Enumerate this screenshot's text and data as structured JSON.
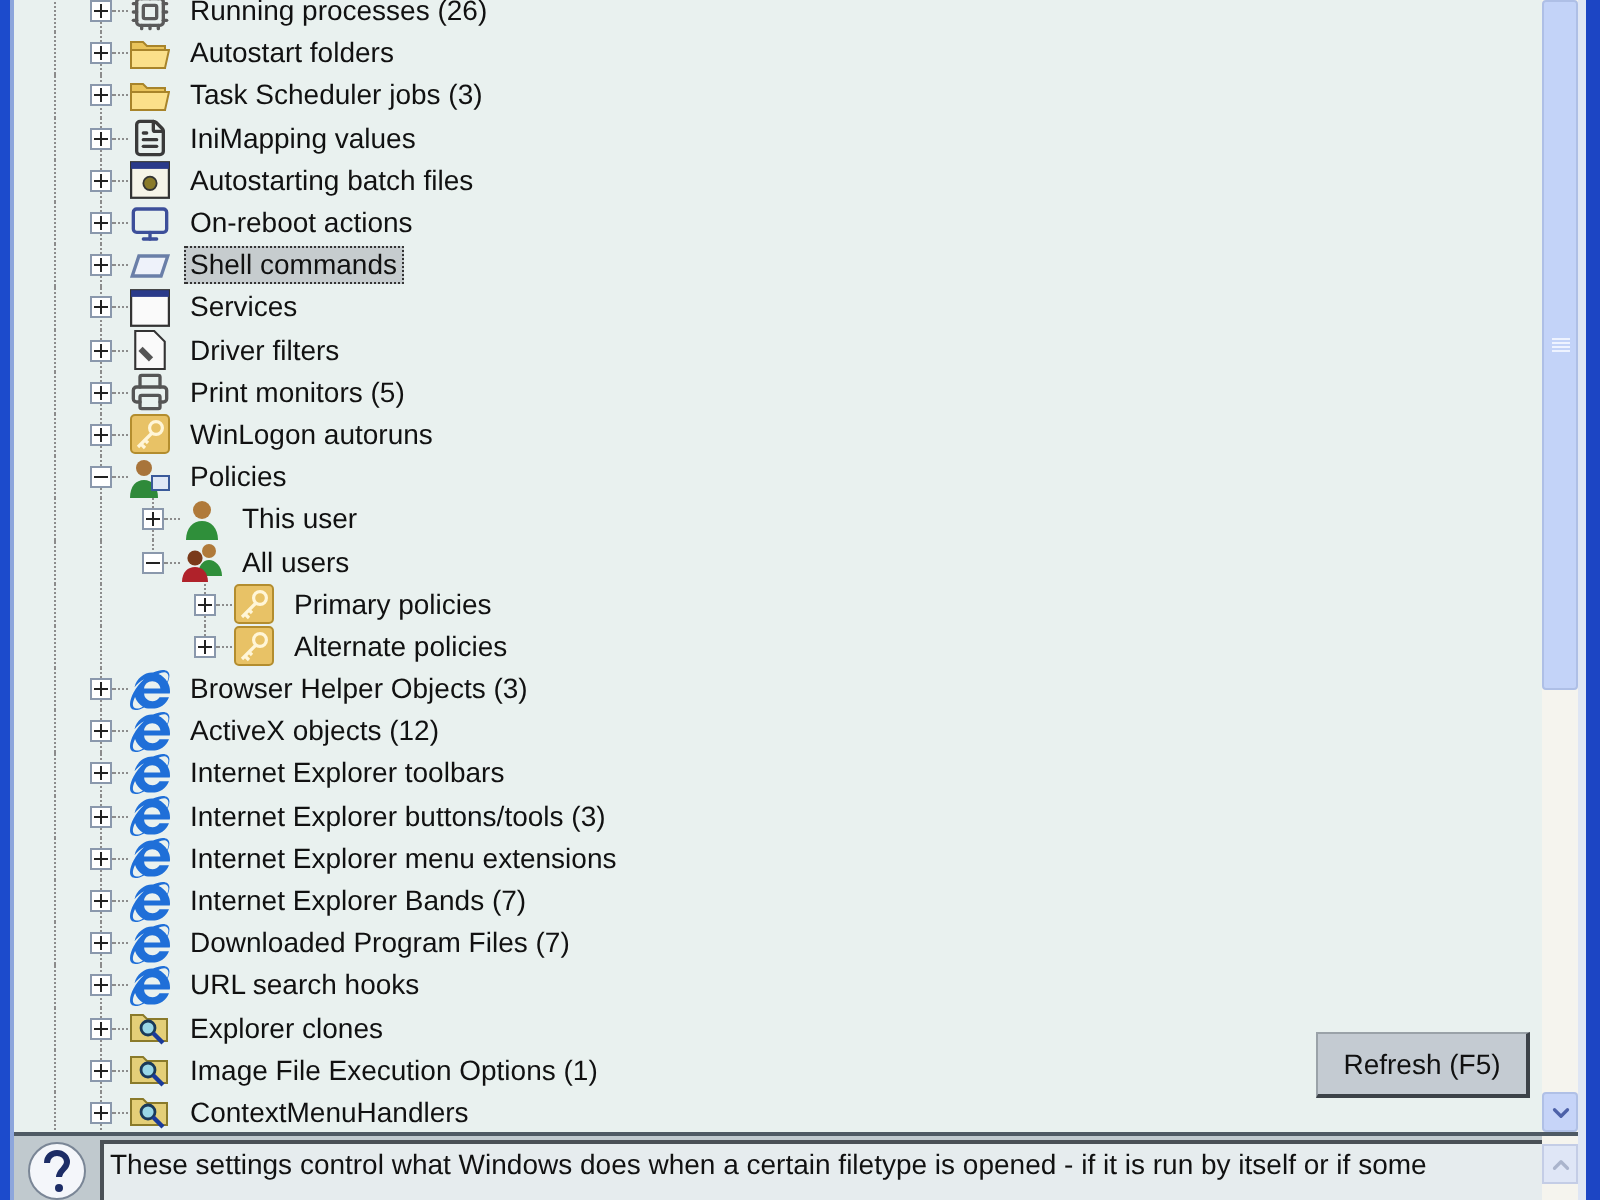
{
  "tree": {
    "items": [
      {
        "label": "Running processes (26)",
        "kind": "chip",
        "expanded": false,
        "selected": false
      },
      {
        "label": "Autostart folders",
        "kind": "folder",
        "expanded": false,
        "selected": false
      },
      {
        "label": "Task Scheduler jobs (3)",
        "kind": "folder",
        "expanded": false,
        "selected": false
      },
      {
        "label": "IniMapping values",
        "kind": "ini-file",
        "expanded": false,
        "selected": false
      },
      {
        "label": "Autostarting batch files",
        "kind": "batch-window",
        "expanded": false,
        "selected": false
      },
      {
        "label": "On-reboot actions",
        "kind": "monitor",
        "expanded": false,
        "selected": false
      },
      {
        "label": "Shell commands",
        "kind": "shell",
        "expanded": false,
        "selected": true
      },
      {
        "label": "Services",
        "kind": "window",
        "expanded": false,
        "selected": false
      },
      {
        "label": "Driver filters",
        "kind": "driver-file",
        "expanded": false,
        "selected": false
      },
      {
        "label": "Print monitors (5)",
        "kind": "printer",
        "expanded": false,
        "selected": false
      },
      {
        "label": "WinLogon autoruns",
        "kind": "key",
        "expanded": false,
        "selected": false
      },
      {
        "label": "Policies",
        "kind": "policy",
        "expanded": true,
        "selected": false,
        "children": [
          {
            "label": "This user",
            "kind": "user",
            "expanded": false,
            "selected": false
          },
          {
            "label": "All users",
            "kind": "users",
            "expanded": true,
            "selected": false,
            "children": [
              {
                "label": "Primary policies",
                "kind": "key",
                "expanded": false,
                "selected": false
              },
              {
                "label": "Alternate policies",
                "kind": "key",
                "expanded": false,
                "selected": false
              }
            ]
          }
        ]
      },
      {
        "label": "Browser Helper Objects (3)",
        "kind": "ie",
        "expanded": false,
        "selected": false
      },
      {
        "label": "ActiveX objects (12)",
        "kind": "ie",
        "expanded": false,
        "selected": false
      },
      {
        "label": "Internet Explorer toolbars",
        "kind": "ie",
        "expanded": false,
        "selected": false
      },
      {
        "label": "Internet Explorer buttons/tools (3)",
        "kind": "ie",
        "expanded": false,
        "selected": false
      },
      {
        "label": "Internet Explorer menu extensions",
        "kind": "ie",
        "expanded": false,
        "selected": false
      },
      {
        "label": "Internet Explorer Bands (7)",
        "kind": "ie",
        "expanded": false,
        "selected": false
      },
      {
        "label": "Downloaded Program Files (7)",
        "kind": "ie",
        "expanded": false,
        "selected": false
      },
      {
        "label": "URL search hooks",
        "kind": "ie",
        "expanded": false,
        "selected": false
      },
      {
        "label": "Explorer clones",
        "kind": "search-folder",
        "expanded": false,
        "selected": false
      },
      {
        "label": "Image File Execution Options (1)",
        "kind": "search-folder",
        "expanded": false,
        "selected": false
      },
      {
        "label": "ContextMenuHandlers",
        "kind": "search-folder",
        "expanded": false,
        "selected": false
      }
    ]
  },
  "refresh_button": {
    "label": "Refresh (F5)"
  },
  "help": {
    "text": "These settings control what Windows does when a certain filetype is opened - if it is run by itself or if some"
  }
}
